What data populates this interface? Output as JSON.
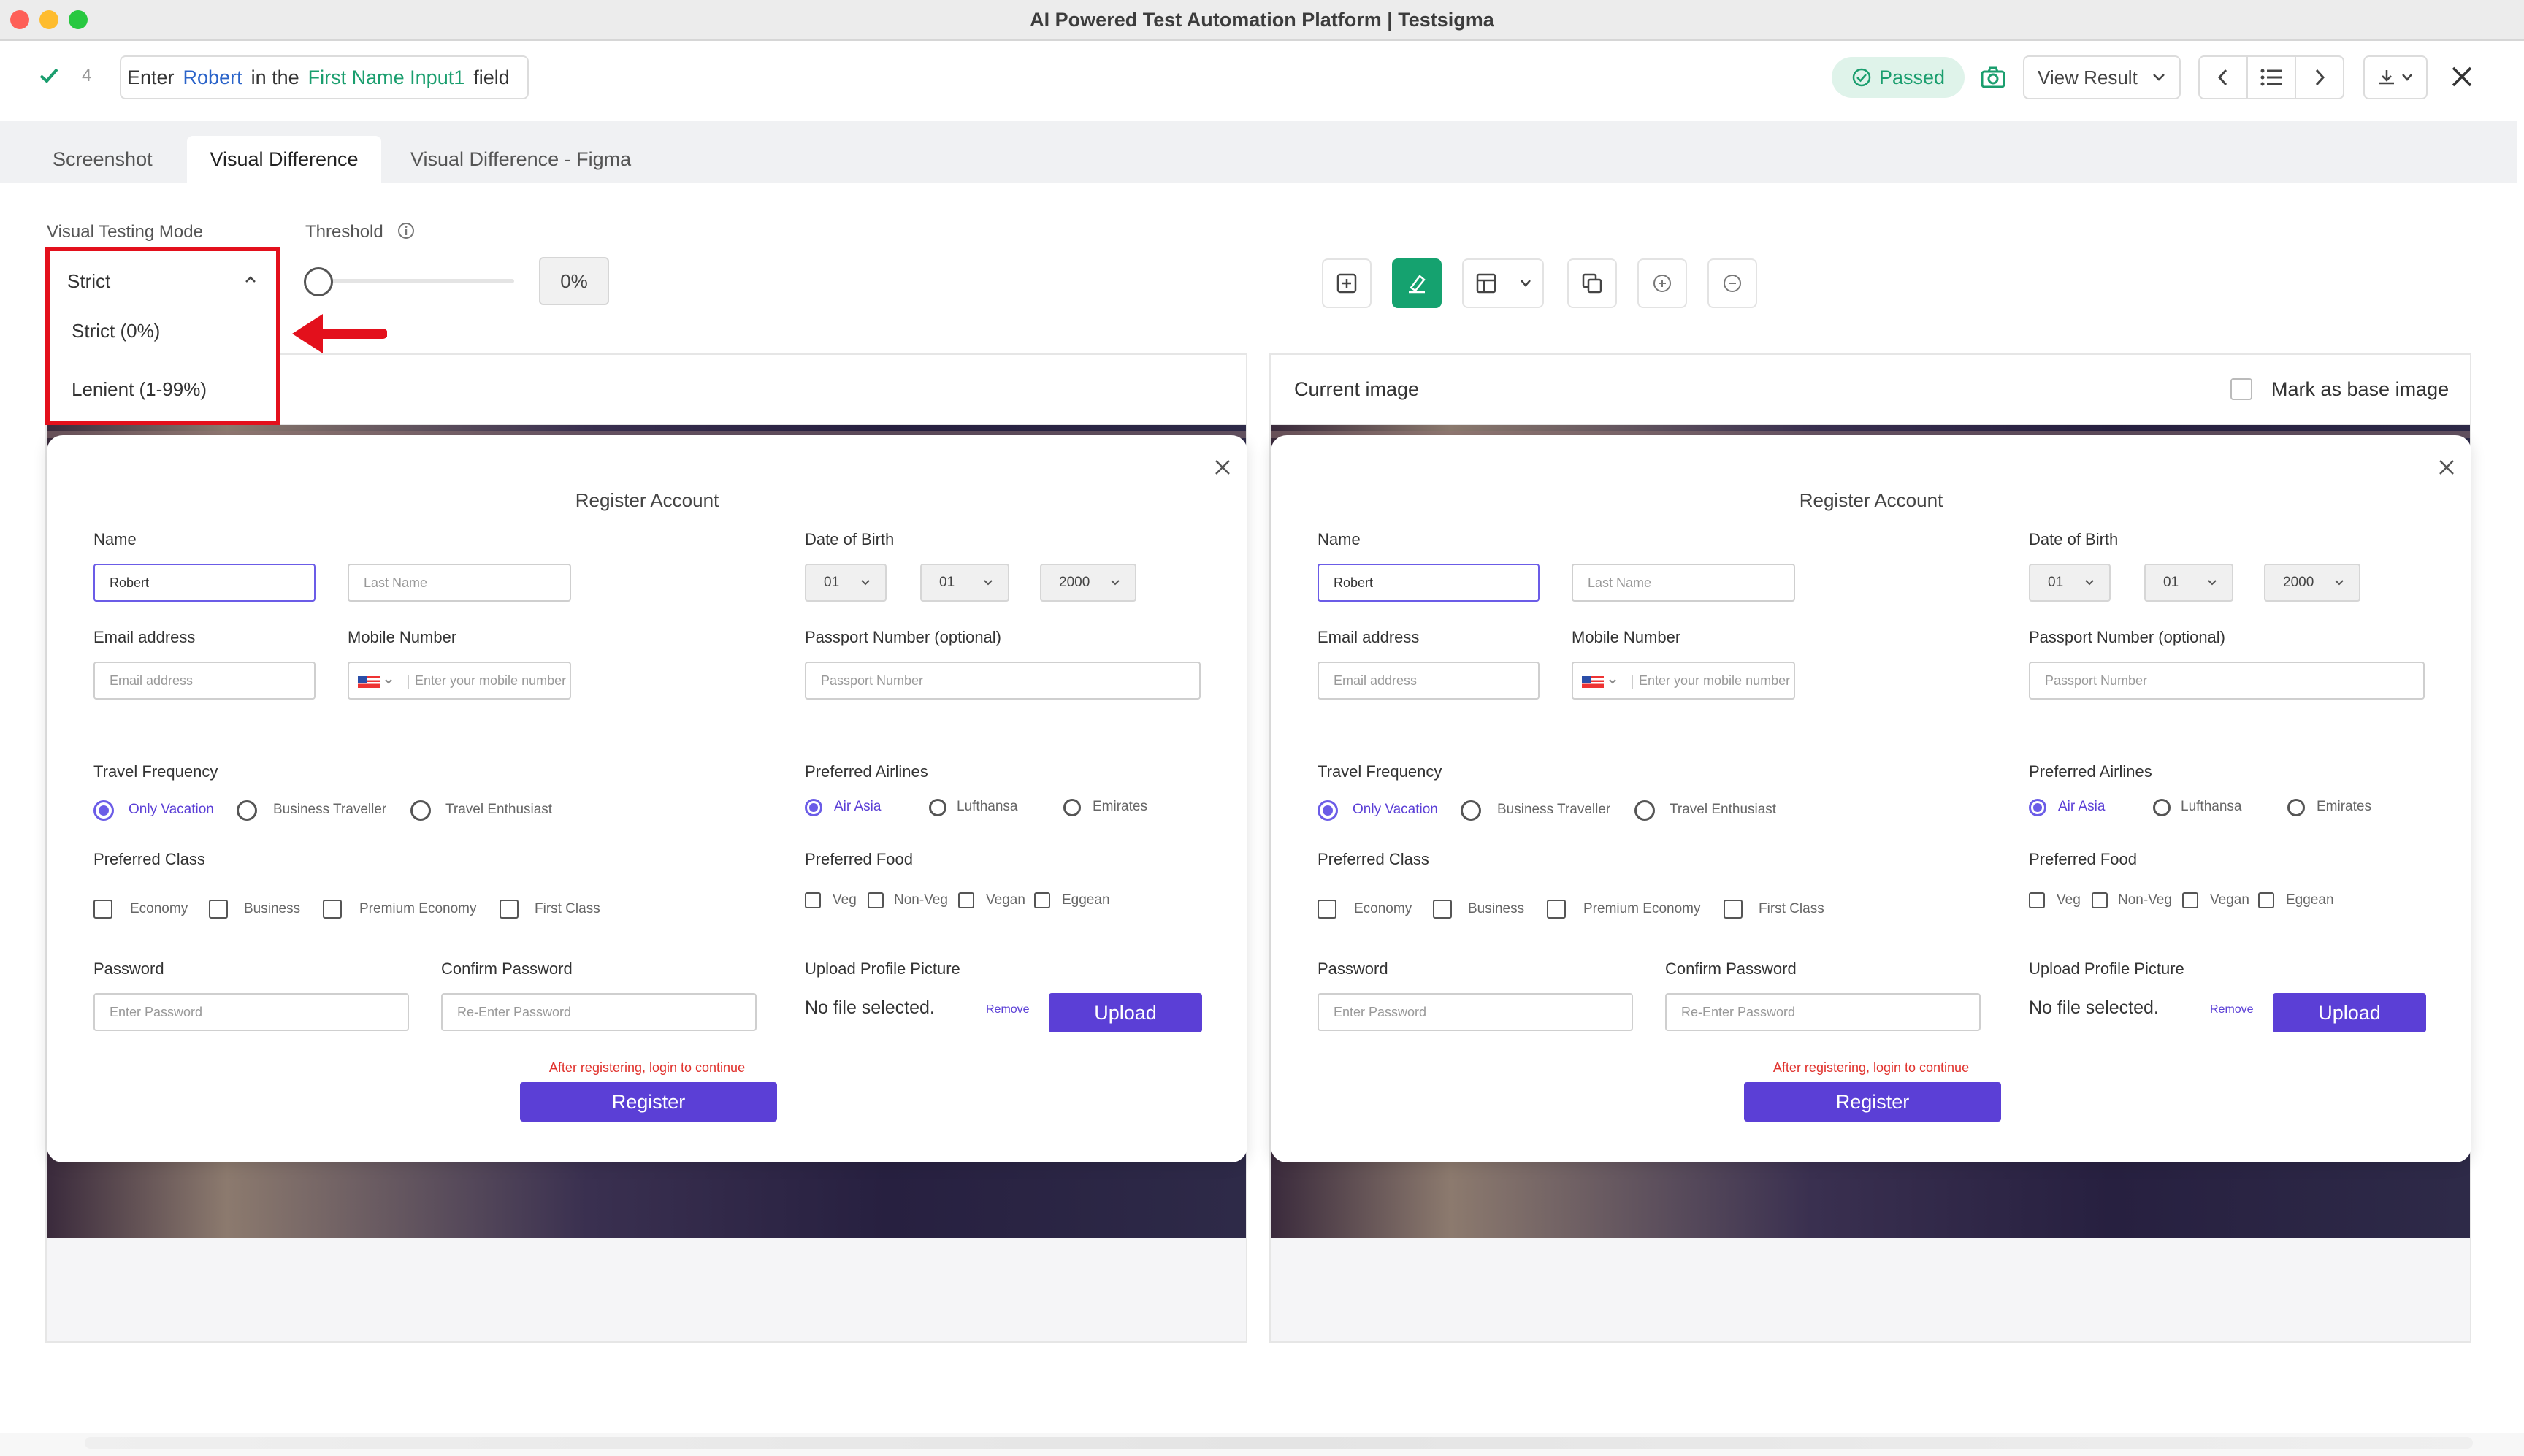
{
  "window": {
    "title": "AI Powered Test Automation Platform | Testsigma"
  },
  "step": {
    "number": "4",
    "word_enter": "Enter",
    "value": "Robert",
    "word_in_the": "in the",
    "element": "First Name Input1",
    "word_field": "field",
    "status": "Passed",
    "view_result": "View Result"
  },
  "tabs": [
    {
      "label": "Screenshot",
      "active": false
    },
    {
      "label": "Visual Difference",
      "active": true
    },
    {
      "label": "Visual Difference - Figma",
      "active": false
    }
  ],
  "controls": {
    "mode_label": "Visual Testing Mode",
    "mode_value": "Strict",
    "mode_options": [
      "Strict (0%)",
      "Lenient (1-99%)"
    ],
    "threshold_label": "Threshold",
    "threshold_value": "0%",
    "threshold_level": 0
  },
  "current": {
    "header": "Current image",
    "mark_base": "Mark as base image"
  },
  "form": {
    "title": "Register Account",
    "name_label": "Name",
    "first_name": "Robert",
    "last_name_placeholder": "Last Name",
    "dob_label": "Date of Birth",
    "dob_day": "01",
    "dob_month": "01",
    "dob_year": "2000",
    "email_label": "Email address",
    "email_placeholder": "Email address",
    "mobile_label": "Mobile Number",
    "mobile_placeholder": "Enter your mobile number",
    "passport_label": "Passport Number (optional)",
    "passport_placeholder": "Passport Number",
    "travel_label": "Travel Frequency",
    "travel_options": [
      "Only Vacation",
      "Business Traveller",
      "Travel Enthusiast"
    ],
    "airlines_label": "Preferred Airlines",
    "airlines_options": [
      "Air Asia",
      "Lufthansa",
      "Emirates"
    ],
    "class_label": "Preferred Class",
    "class_options": [
      "Economy",
      "Business",
      "Premium Economy",
      "First Class"
    ],
    "food_label": "Preferred Food",
    "food_options": [
      "Veg",
      "Non-Veg",
      "Vegan",
      "Eggean"
    ],
    "password_label": "Password",
    "password_placeholder": "Enter Password",
    "confirm_label": "Confirm Password",
    "confirm_placeholder": "Re-Enter Password",
    "upload_label": "Upload Profile Picture",
    "no_file": "No file selected.",
    "remove": "Remove",
    "upload": "Upload",
    "notice": "After registering, login to continue",
    "register": "Register"
  },
  "colors": {
    "accent": "#5b3fd6",
    "success": "#1a9e6e",
    "annotation": "#e3101c"
  }
}
